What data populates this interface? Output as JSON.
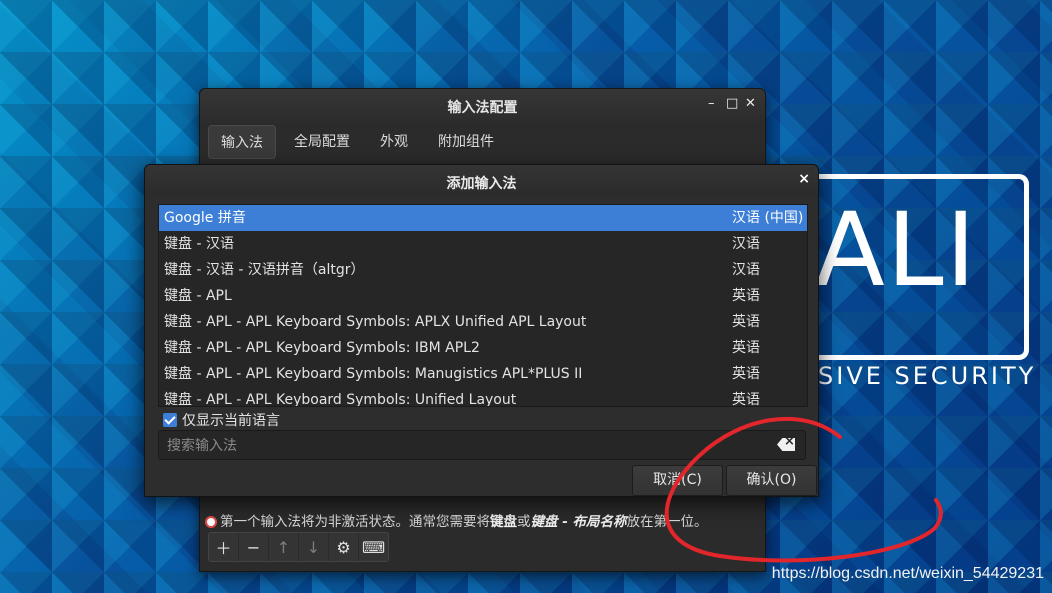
{
  "desktop": {
    "logo_text": "ALI",
    "logo_subtitle": "SIVE SECURITY",
    "watermark": "https://blog.csdn.net/weixin_54429231"
  },
  "back_window": {
    "title": "输入法配置",
    "controls": [
      "–",
      "□",
      "✕"
    ],
    "tabs": [
      "输入法",
      "全局配置",
      "外观",
      "附加组件"
    ],
    "note_prefix": "第一个输入法将为非激活状态。通常您需要将",
    "note_bold1": "键盘",
    "note_mid": "或",
    "note_bold2": "键盘 - 布局名称",
    "note_suffix": "放在第一位。"
  },
  "dialog": {
    "title": "添加输入法",
    "close": "×",
    "rows": [
      {
        "name": "Google 拼音",
        "lang": "汉语 (中国)"
      },
      {
        "name": "键盘 - 汉语",
        "lang": "汉语"
      },
      {
        "name": "键盘 - 汉语 - 汉语拼音（altgr）",
        "lang": "汉语"
      },
      {
        "name": "键盘 - APL",
        "lang": "英语"
      },
      {
        "name": "键盘 - APL - APL Keyboard Symbols: APLX Unified APL Layout",
        "lang": "英语"
      },
      {
        "name": "键盘 - APL - APL Keyboard Symbols: IBM APL2",
        "lang": "英语"
      },
      {
        "name": "键盘 - APL - APL Keyboard Symbols: Manugistics APL*PLUS II",
        "lang": "英语"
      },
      {
        "name": "键盘 - APL - APL Keyboard Symbols: Unified Layout",
        "lang": "英语"
      }
    ],
    "checkbox_label": "仅显示当前语言",
    "search_placeholder": "搜索输入法",
    "cancel_label": "取消(C)",
    "ok_label": "确认(O)"
  }
}
